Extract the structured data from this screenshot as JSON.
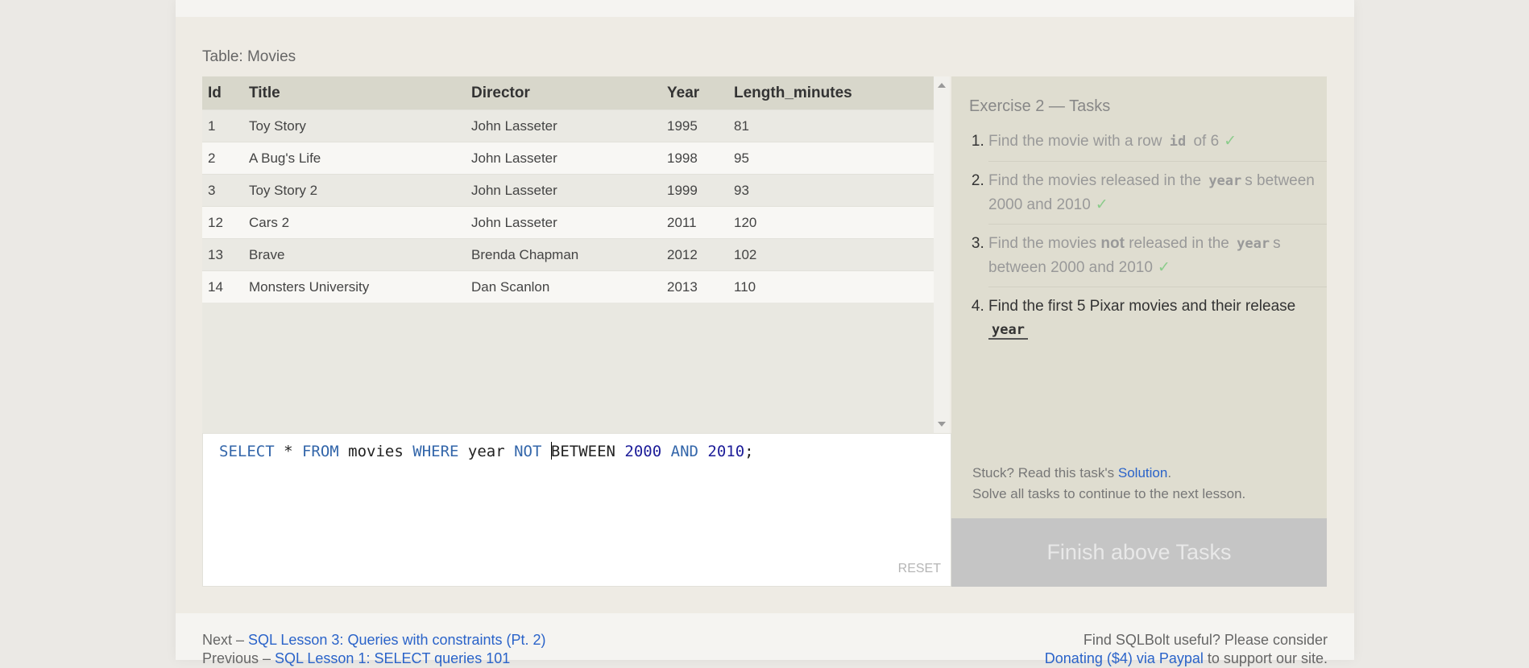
{
  "table": {
    "label": "Table: Movies",
    "columns": [
      "Id",
      "Title",
      "Director",
      "Year",
      "Length_minutes"
    ],
    "rows": [
      [
        "1",
        "Toy Story",
        "John Lasseter",
        "1995",
        "81"
      ],
      [
        "2",
        "A Bug's Life",
        "John Lasseter",
        "1998",
        "95"
      ],
      [
        "3",
        "Toy Story 2",
        "John Lasseter",
        "1999",
        "93"
      ],
      [
        "12",
        "Cars 2",
        "John Lasseter",
        "2011",
        "120"
      ],
      [
        "13",
        "Brave",
        "Brenda Chapman",
        "2012",
        "102"
      ],
      [
        "14",
        "Monsters University",
        "Dan Scanlon",
        "2013",
        "110"
      ]
    ]
  },
  "editor": {
    "tokens": {
      "select": "SELECT",
      "star": " * ",
      "from": "FROM",
      "table": " movies ",
      "where": "WHERE",
      "col": " year ",
      "not": "NOT",
      "sp": " ",
      "between": "BETWEEN",
      "n1": "2000",
      "and": "AND",
      "n2": "2010",
      "semi": ";"
    },
    "reset_label": "RESET"
  },
  "tasks": {
    "title": "Exercise 2 — Tasks",
    "items": [
      {
        "pre": "Find the movie with a row ",
        "code": "id",
        "post": " of 6",
        "check": "✓"
      },
      {
        "pre": "Find the movies released in the ",
        "code": "year",
        "post": "s between 2000 and 2010",
        "check": "✓"
      },
      {
        "pre": "Find the movies ",
        "bold": "not",
        "mid": " released in the ",
        "code": "year",
        "post": "s between 2000 and 2010",
        "check": "✓"
      },
      {
        "pre": "Find the first 5 Pixar movies and their release ",
        "code": "year"
      }
    ],
    "stuck_prefix": "Stuck? Read this task's ",
    "solution_label": "Solution",
    "stuck_suffix": ".",
    "solve_all": "Solve all tasks to continue to the next lesson.",
    "finish_label": "Finish above Tasks"
  },
  "footer": {
    "next_prefix": "Next – ",
    "next_link": "SQL Lesson 3: Queries with constraints (Pt. 2)",
    "prev_prefix": "Previous – ",
    "prev_link": "SQL Lesson 1: SELECT queries 101",
    "useful": "Find SQLBolt useful? Please consider",
    "donate_link": "Donating ($4) via Paypal",
    "donate_suffix": " to support our site."
  },
  "colors": {
    "link": "#2a63c9",
    "keyword": "#3366aa",
    "check": "#8ccc8c",
    "finish_bg": "#c5c5c5"
  }
}
